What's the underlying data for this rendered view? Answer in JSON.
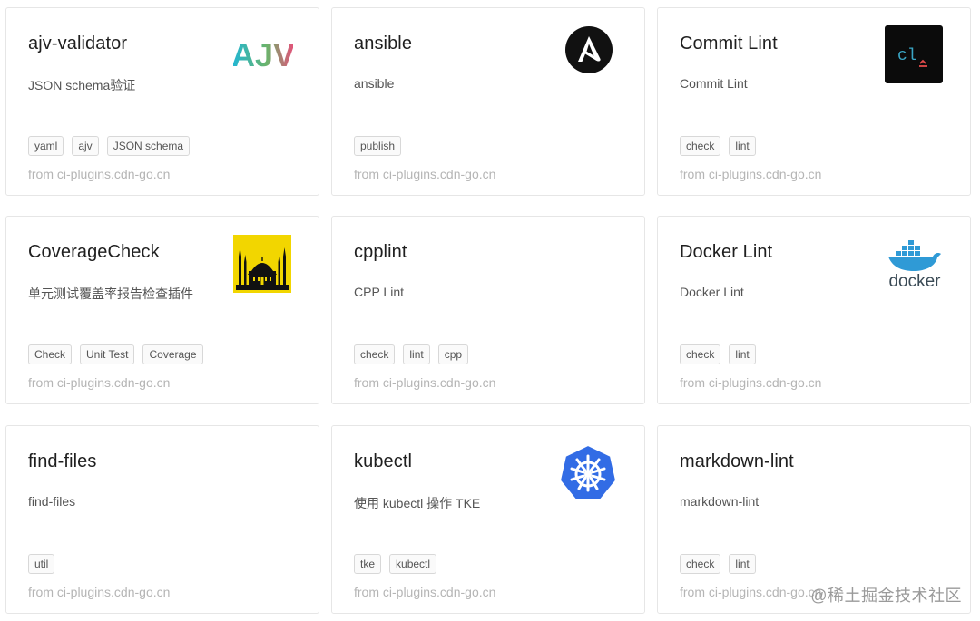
{
  "cards": [
    {
      "title": "ajv-validator",
      "description": "JSON schema验证",
      "tags": [
        "yaml",
        "ajv",
        "JSON schema"
      ],
      "source": "from ci-plugins.cdn-go.cn",
      "logo": "ajv-logo-icon",
      "logo_text": "AJV"
    },
    {
      "title": "ansible",
      "description": "ansible",
      "tags": [
        "publish"
      ],
      "source": "from ci-plugins.cdn-go.cn",
      "logo": "ansible-logo-icon",
      "logo_text": "A"
    },
    {
      "title": "Commit Lint",
      "description": "Commit Lint",
      "tags": [
        "check",
        "lint"
      ],
      "source": "from ci-plugins.cdn-go.cn",
      "logo": "commitlint-logo-icon",
      "logo_text": "cl"
    },
    {
      "title": "CoverageCheck",
      "description": "单元测试覆盖率报告检查插件",
      "tags": [
        "Check",
        "Unit Test",
        "Coverage"
      ],
      "source": "from ci-plugins.cdn-go.cn",
      "logo": "mosque-logo-icon"
    },
    {
      "title": "cpplint",
      "description": "CPP Lint",
      "tags": [
        "check",
        "lint",
        "cpp"
      ],
      "source": "from ci-plugins.cdn-go.cn",
      "logo": ""
    },
    {
      "title": "Docker Lint",
      "description": "Docker Lint",
      "tags": [
        "check",
        "lint"
      ],
      "source": "from ci-plugins.cdn-go.cn",
      "logo": "docker-logo-icon",
      "logo_text": "docker"
    },
    {
      "title": "find-files",
      "description": "find-files",
      "tags": [
        "util"
      ],
      "source": "from ci-plugins.cdn-go.cn",
      "logo": ""
    },
    {
      "title": "kubectl",
      "description": "使用 kubectl 操作 TKE",
      "tags": [
        "tke",
        "kubectl"
      ],
      "source": "from ci-plugins.cdn-go.cn",
      "logo": "kubernetes-logo-icon"
    },
    {
      "title": "markdown-lint",
      "description": "markdown-lint",
      "tags": [
        "check",
        "lint"
      ],
      "source": "from ci-plugins.cdn-go.cn",
      "logo": ""
    }
  ],
  "watermark": "@稀土掘金技术社区",
  "colors": {
    "ajv_gradient_start": "#1fb6d6",
    "ajv_gradient_end": "#e94d7a",
    "commitlint_accent": "#e34b4b",
    "commitlint_text": "#3aa6c5",
    "coverage_bg": "#f2d600",
    "docker_blue": "#2f9ad6",
    "kubernetes_blue": "#326ce5"
  }
}
